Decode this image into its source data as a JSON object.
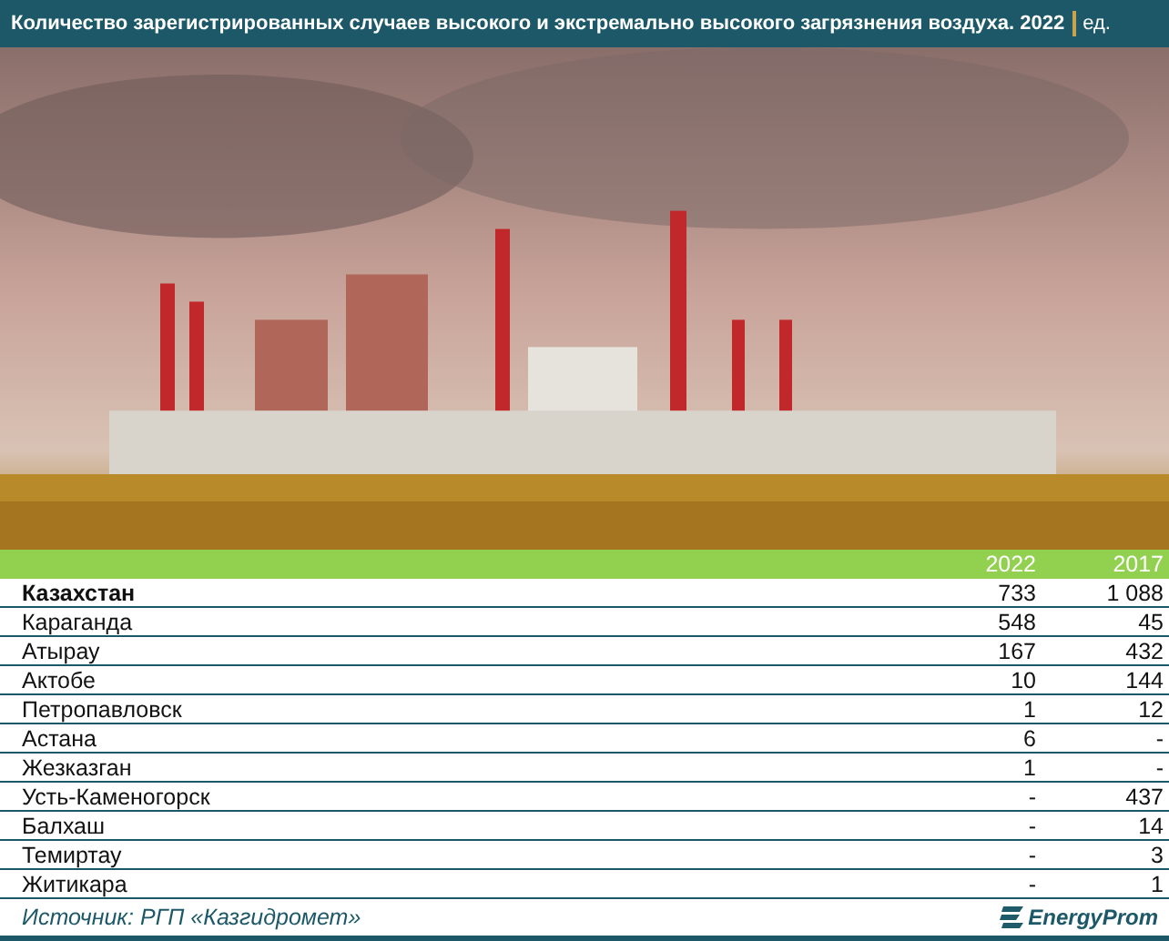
{
  "title": "Количество зарегистрированных случаев высокого и экстремально высокого загрязнения воздуха. 2022",
  "unit": "ед.",
  "table": {
    "columns": [
      "2022",
      "2017"
    ],
    "rows": [
      {
        "label": "Казахстан",
        "values": [
          "733",
          "1 088"
        ],
        "bold": true
      },
      {
        "label": "Караганда",
        "values": [
          "548",
          "45"
        ],
        "bold": false
      },
      {
        "label": "Атырау",
        "values": [
          "167",
          "432"
        ],
        "bold": false
      },
      {
        "label": "Актобе",
        "values": [
          "10",
          "144"
        ],
        "bold": false
      },
      {
        "label": "Петропавловск",
        "values": [
          "1",
          "12"
        ],
        "bold": false
      },
      {
        "label": "Астана",
        "values": [
          "6",
          "-"
        ],
        "bold": false
      },
      {
        "label": "Жезказган",
        "values": [
          "1",
          "-"
        ],
        "bold": false
      },
      {
        "label": "Усть-Каменогорск",
        "values": [
          "-",
          "437"
        ],
        "bold": false
      },
      {
        "label": "Балхаш",
        "values": [
          "-",
          "14"
        ],
        "bold": false
      },
      {
        "label": "Темиртау",
        "values": [
          "-",
          "3"
        ],
        "bold": false
      },
      {
        "label": "Житикара",
        "values": [
          "-",
          "1"
        ],
        "bold": false
      }
    ]
  },
  "source": "Источник: РГП «Казгидромет»",
  "logo": "EnergyProm"
}
